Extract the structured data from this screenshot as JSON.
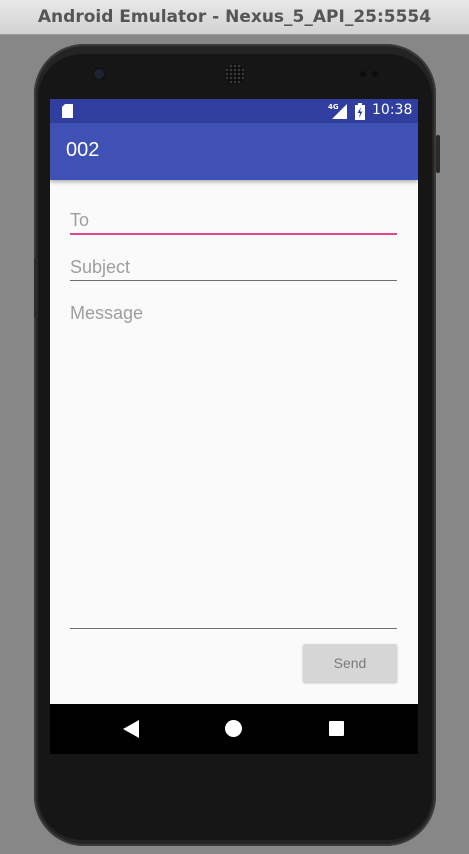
{
  "window": {
    "title": "Android Emulator - Nexus_5_API_25:5554"
  },
  "status_bar": {
    "network": "4G",
    "time": "10:38"
  },
  "app_bar": {
    "title": "002"
  },
  "form": {
    "to_placeholder": "To",
    "subject_placeholder": "Subject",
    "message_placeholder": "Message",
    "to_value": "",
    "subject_value": "",
    "message_value": ""
  },
  "send_button": {
    "label": "Send"
  },
  "colors": {
    "status_bar": "#303f9f",
    "app_bar": "#3f51b5",
    "focus_accent": "#e0478a",
    "button": "#d6d6d6"
  },
  "icons": {
    "status": [
      "sd-card-icon",
      "signal-icon",
      "battery-charging-icon"
    ],
    "navigation": [
      "back-icon",
      "home-icon",
      "recents-icon"
    ]
  }
}
